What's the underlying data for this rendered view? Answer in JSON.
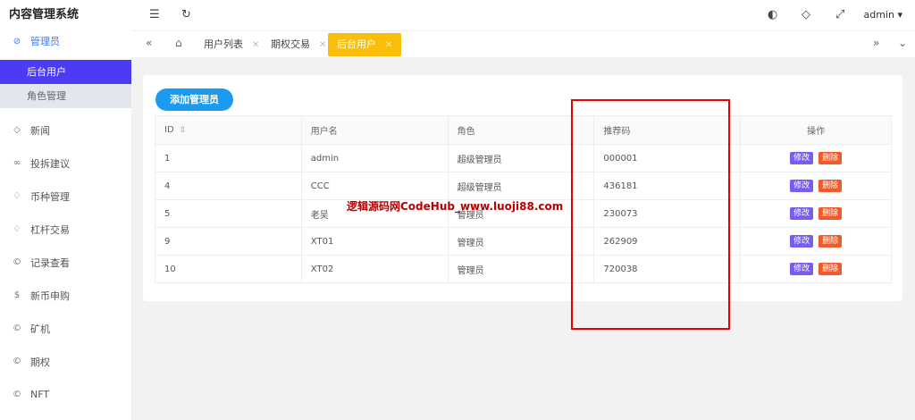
{
  "app": {
    "title": "内容管理系统"
  },
  "sidebar": {
    "group": {
      "label": "管理员",
      "icon": "shield-check-icon"
    },
    "sub_items": [
      {
        "label": "后台用户",
        "active": true
      },
      {
        "label": "角色管理",
        "active": false
      }
    ],
    "items": [
      {
        "label": "新闻",
        "icon": "tag-icon"
      },
      {
        "label": "投拆建议",
        "icon": "link-icon"
      },
      {
        "label": "币种管理",
        "icon": "diamond-icon"
      },
      {
        "label": "杠杆交易",
        "icon": "diamond-icon"
      },
      {
        "label": "记录查看",
        "icon": "circle-c-icon"
      },
      {
        "label": "新币申购",
        "icon": "dollar-icon"
      },
      {
        "label": "矿机",
        "icon": "circle-c-icon"
      },
      {
        "label": "期权",
        "icon": "circle-c-icon"
      },
      {
        "label": "NFT",
        "icon": "circle-c-icon"
      }
    ]
  },
  "header": {
    "user": "admin"
  },
  "tabs": [
    {
      "label": "用户列表",
      "active": false
    },
    {
      "label": "期权交易",
      "active": false
    },
    {
      "label": "后台用户",
      "active": true
    }
  ],
  "main": {
    "add_button": "添加管理员",
    "table": {
      "columns": [
        "ID",
        "用户名",
        "角色",
        "推荐码",
        "操作"
      ],
      "rows": [
        {
          "id": "1",
          "username": "admin",
          "role": "超级管理员",
          "code": "000001"
        },
        {
          "id": "4",
          "username": "CCC",
          "role": "超级管理员",
          "code": "436181"
        },
        {
          "id": "5",
          "username": "老吴",
          "role": "管理员",
          "code": "230073"
        },
        {
          "id": "9",
          "username": "XT01",
          "role": "管理员",
          "code": "262909"
        },
        {
          "id": "10",
          "username": "XT02",
          "role": "管理员",
          "code": "720038"
        }
      ],
      "edit_label": "修改",
      "delete_label": "删除"
    }
  },
  "watermark": "逻辑源码网CodeHub_www.luoji88.com",
  "colors": {
    "accent": "#4b3bf5",
    "active_tab": "#fbbf0b",
    "primary": "#1a9bf0",
    "edit": "#7b5cf0",
    "delete": "#f05b2b",
    "highlight_box": "#ee0000"
  }
}
